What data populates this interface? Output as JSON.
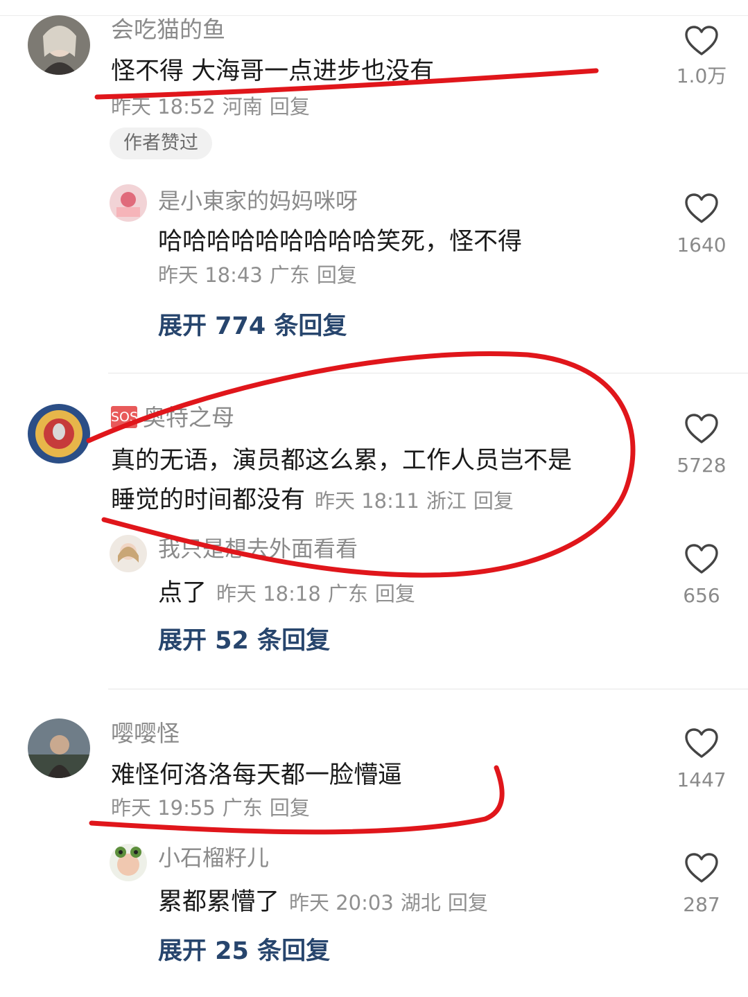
{
  "comments": [
    {
      "user": "会吃猫的鱼",
      "text": "怪不得 大海哥一点进步也没有",
      "time": "昨天 18:52",
      "location": "河南",
      "reply": "回复",
      "badge": "作者赞过",
      "likes": "1.0万",
      "replies": [
        {
          "user": "是小東家的妈妈咪呀",
          "text": "哈哈哈哈哈哈哈哈哈笑死，怪不得",
          "time": "昨天 18:43",
          "location": "广东",
          "reply": "回复",
          "likes": "1640"
        }
      ],
      "expand": "展开 774 条回复"
    },
    {
      "user_badge": "SOS",
      "user": "奥特之母",
      "text_line1": "真的无语，演员都这么累，工作人员岂不是",
      "text_line2": "睡觉的时间都没有",
      "time": "昨天 18:11",
      "location": "浙江",
      "reply": "回复",
      "likes": "5728",
      "replies": [
        {
          "user": "我只是想去外面看看",
          "text": "点了",
          "time": "昨天 18:18",
          "location": "广东",
          "reply": "回复",
          "likes": "656"
        }
      ],
      "expand": "展开 52 条回复"
    },
    {
      "user": "嘤嘤怪",
      "text": "难怪何洛洛每天都一脸懵逼",
      "time": "昨天 19:55",
      "location": "广东",
      "reply": "回复",
      "likes": "1447",
      "replies": [
        {
          "user": "小石榴籽儿",
          "text": "累都累懵了",
          "time": "昨天 20:03",
          "location": "湖北",
          "reply": "回复",
          "likes": "287"
        }
      ],
      "expand": "展开 25 条回复"
    }
  ],
  "icons": {
    "like": "heart-outline-icon"
  },
  "colors": {
    "annotation": "#e0161b",
    "expand_link": "#27456d",
    "meta_text": "#8f8f8f"
  }
}
